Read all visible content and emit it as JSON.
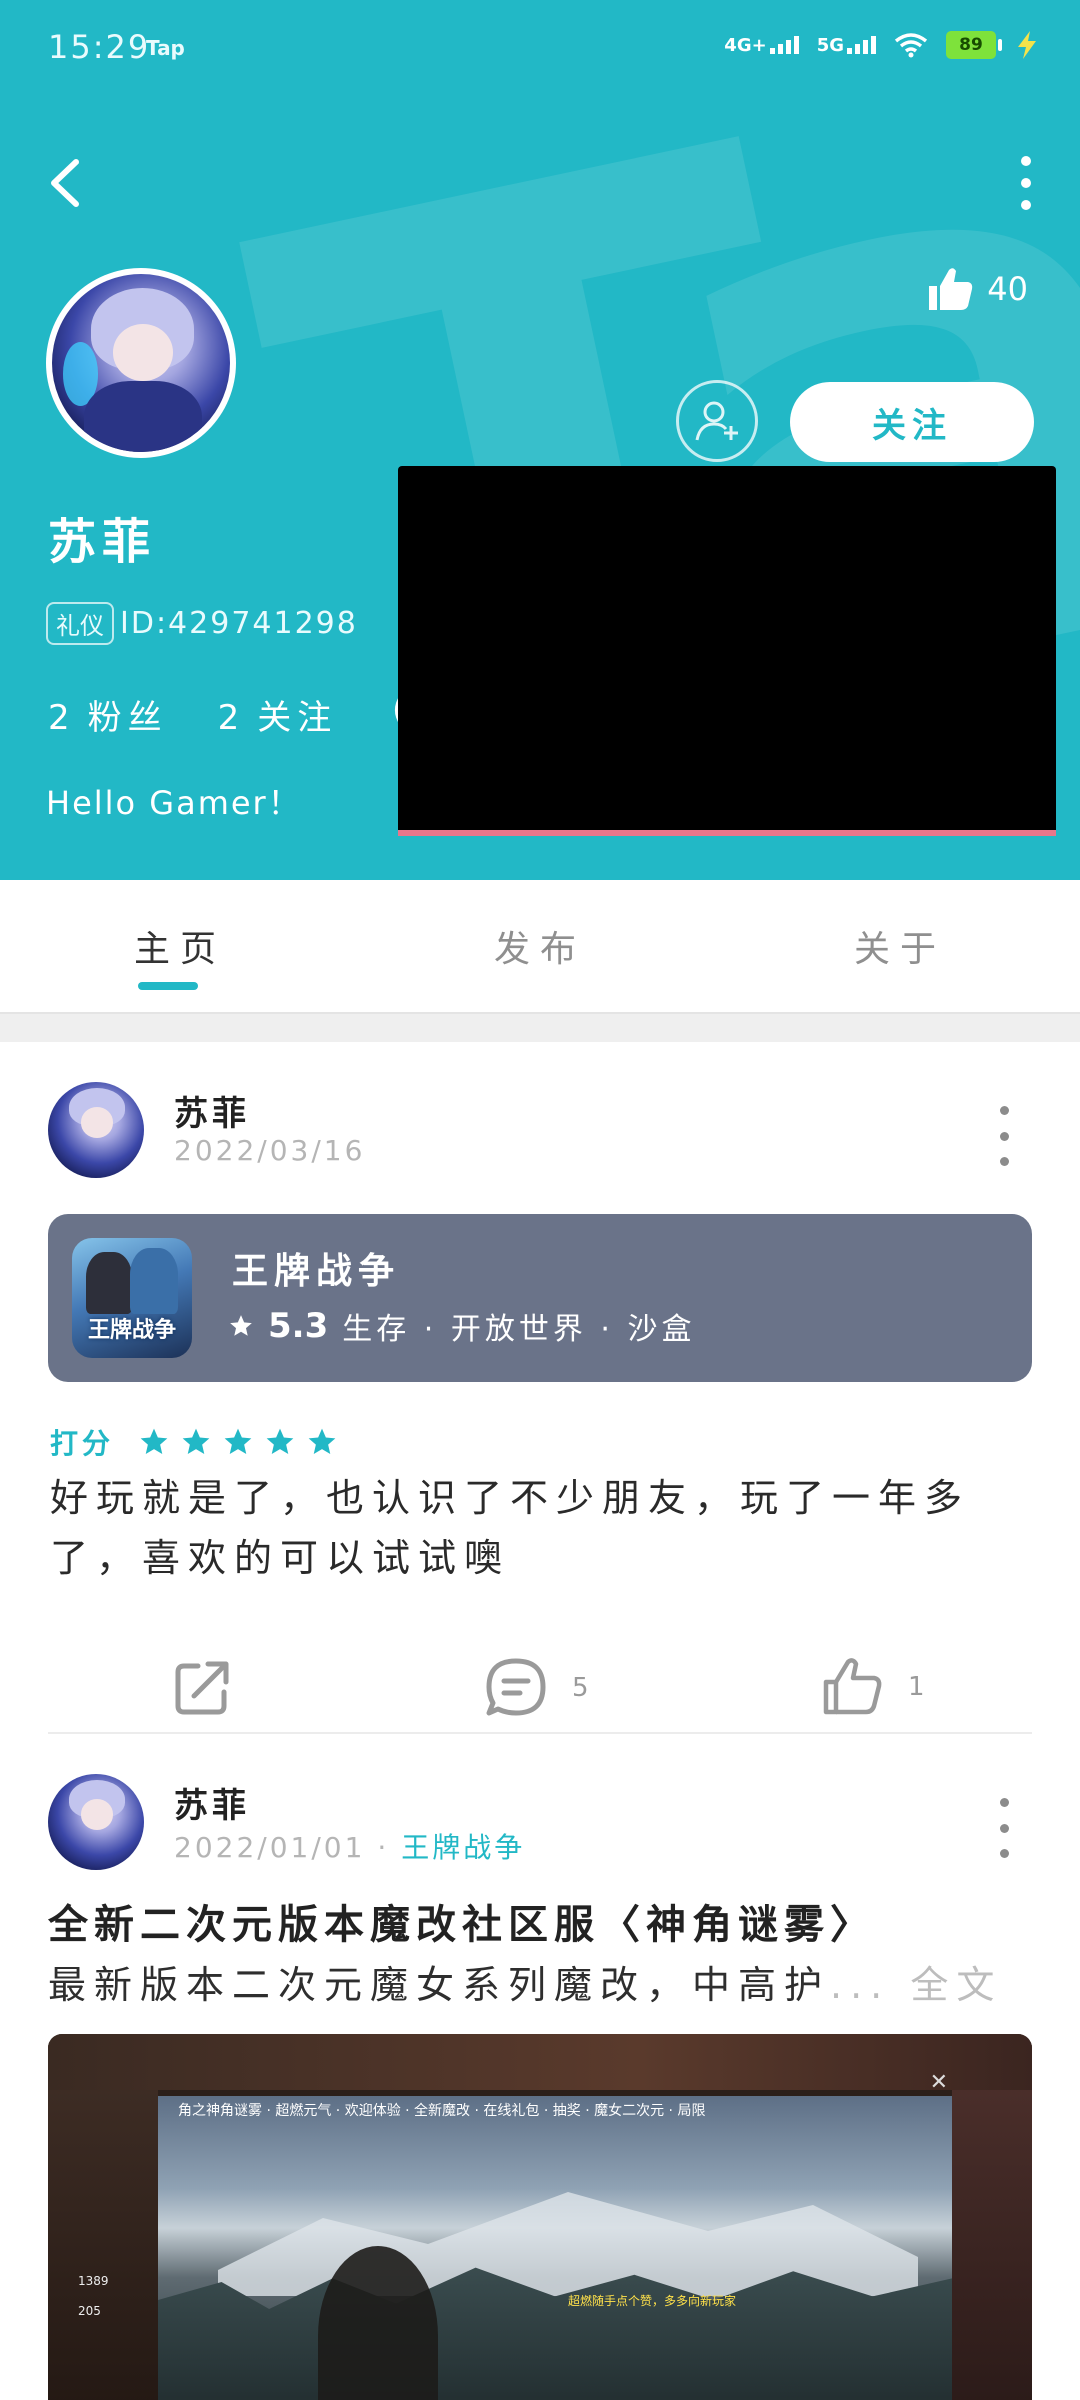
{
  "status_bar": {
    "time": "15:29",
    "app_tag": "Tap",
    "network1": "4G+",
    "network2": "5G",
    "battery": "89"
  },
  "profile": {
    "name": "苏菲",
    "id_tag": "礼仪",
    "id_text": "ID:429741298",
    "fans_count": "2",
    "fans_label": "粉丝",
    "following_count": "2",
    "following_label": "关注",
    "stats_extra": "(",
    "bio": "Hello Gamer！",
    "likes": "40",
    "follow_button": "关注"
  },
  "tabs": [
    {
      "label": "主页",
      "active": true
    },
    {
      "label": "发布",
      "active": false
    },
    {
      "label": "关于",
      "active": false
    }
  ],
  "posts": [
    {
      "author": "苏菲",
      "date": "2022/03/16",
      "game": {
        "name": "王牌战争",
        "icon_text": "王牌战争",
        "score": "5.3",
        "tags": "生存 · 开放世界 · 沙盒"
      },
      "rating_label": "打分",
      "rating_stars": 5,
      "text": "好玩就是了，也认识了不少朋友，玩了一年多了，喜欢的可以试试噢",
      "comments": "5",
      "likes": "1"
    },
    {
      "author": "苏菲",
      "date": "2022/01/01",
      "dot": "·",
      "game_link": "王牌战争",
      "title": "全新二次元版本魔改社区服〈神角谜雾〉",
      "excerpt": "最新版本二次元魔女系列魔改，中高护",
      "more": "... 全文",
      "image": {
        "caption": "角之神角谜雾 · 超燃元气 · 欢迎体验 · 全新魔改 · 在线礼包 · 抽奖 · 魔女二次元 · 局限",
        "count1": "1389",
        "count2": "205",
        "ticker": "超燃随手点个赞，多多向新玩家"
      }
    }
  ],
  "colors": {
    "accent": "#22b8c6",
    "card": "#6a7389",
    "star": "#22b8c6"
  }
}
